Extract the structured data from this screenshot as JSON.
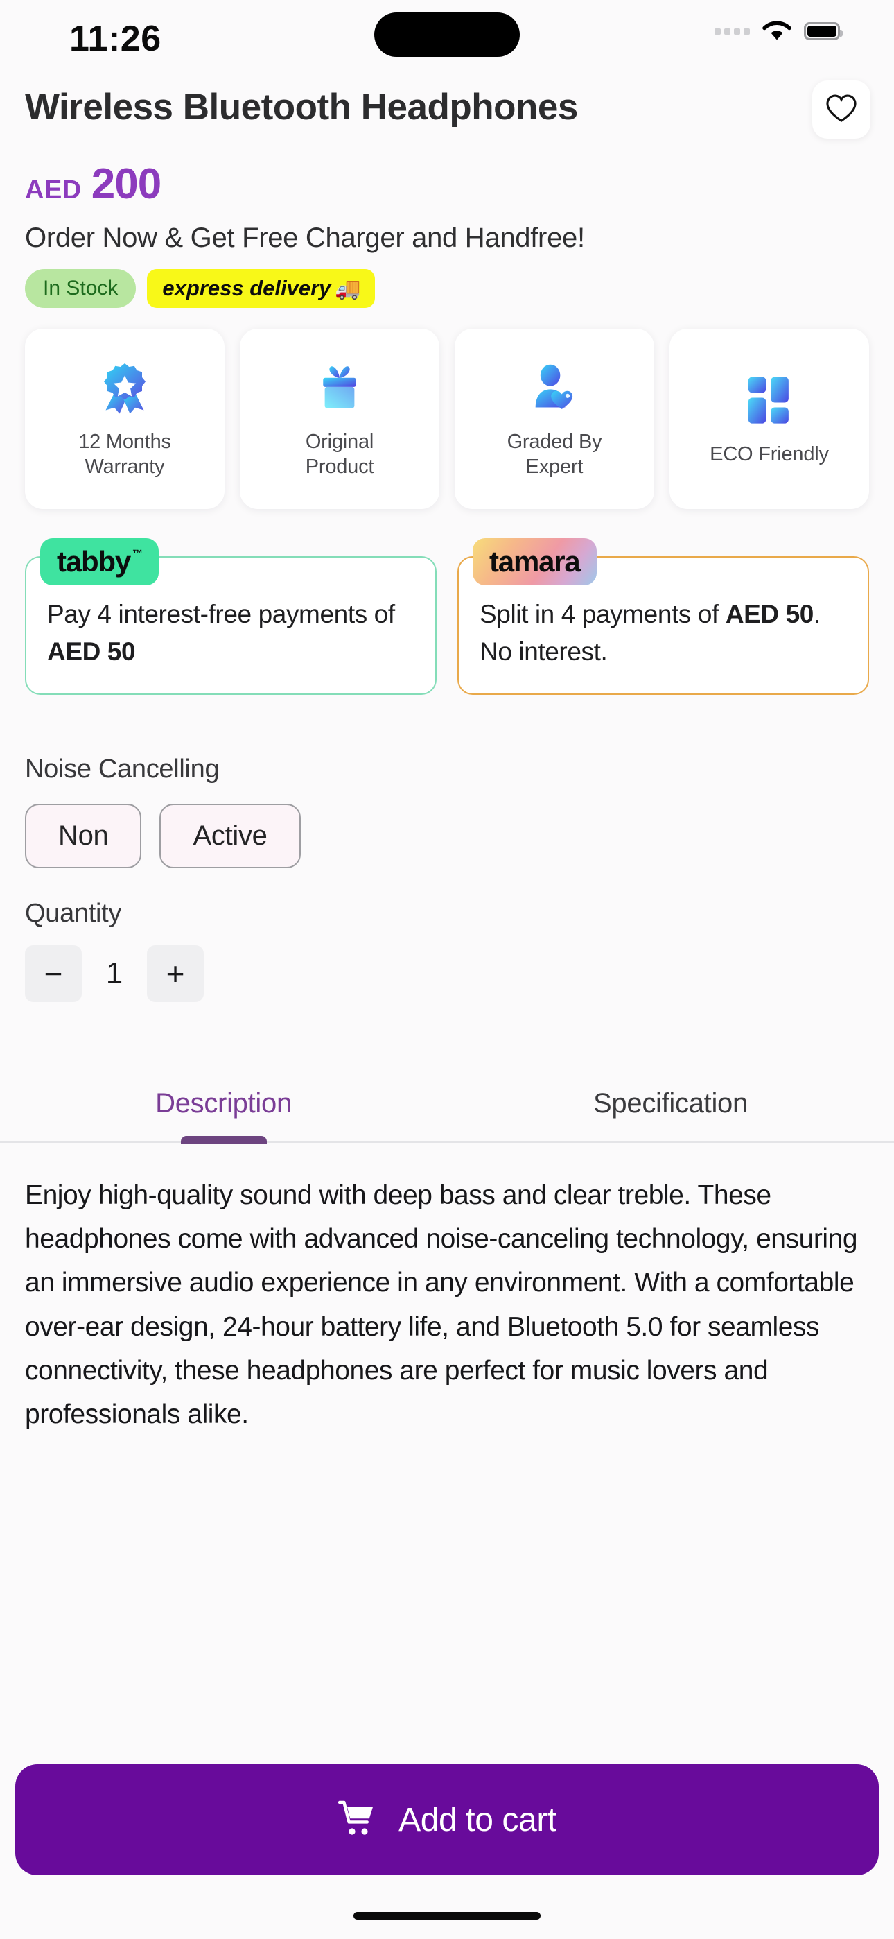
{
  "status_bar": {
    "time": "11:26",
    "icons": [
      "signal-dots-icon",
      "wifi-icon",
      "battery-icon"
    ]
  },
  "header": {
    "title": "Wireless Bluetooth Headphones",
    "favorite_icon": "heart-outline-icon"
  },
  "price": {
    "currency": "AED",
    "amount": "200",
    "color": "#8c3bbd"
  },
  "promo_text": "Order Now & Get Free Charger and Handfree!",
  "badges": {
    "stock": "In Stock",
    "stock_bg": "#b8e6a0",
    "stock_color": "#1d6b1d",
    "express": "express delivery",
    "express_icon": "🚚",
    "express_bg": "#f8f818"
  },
  "features": [
    {
      "icon": "medal-badge-icon",
      "label": "12 Months\nWarranty",
      "line1": "12 Months",
      "line2": "Warranty"
    },
    {
      "icon": "gift-box-icon",
      "label": "Original Product",
      "line1": "Original",
      "line2": "Product"
    },
    {
      "icon": "person-heart-icon",
      "label": "Graded By Expert",
      "line1": "Graded By",
      "line2": "Expert"
    },
    {
      "icon": "grid-blocks-icon",
      "label": "ECO Friendly",
      "line1": "ECO Friendly",
      "line2": ""
    }
  ],
  "bnpl": [
    {
      "brand": "tabby",
      "trademark": "™",
      "text_plain": "Pay 4 interest-free payments of AED 50",
      "text_pre": "Pay 4 interest-free payments of ",
      "text_bold": "AED 50",
      "text_post": "",
      "border_color": "#84ddb8",
      "badge_color": "#3fe3a0"
    },
    {
      "brand": "tamara",
      "trademark": "",
      "text_plain": "Split in 4 payments of AED 50. No interest.",
      "text_pre": "Split in 4 payments of ",
      "text_bold": "AED 50",
      "text_post": ". No interest.",
      "border_color": "#e9a94a",
      "badge_color": "gradient-yellow-pink-blue"
    }
  ],
  "options": {
    "noise_label": "Noise Cancelling",
    "noise_values": [
      "Non",
      "Active"
    ],
    "quantity_label": "Quantity",
    "quantity_value": "1",
    "minus_icon": "−",
    "plus_icon": "+"
  },
  "tabs": [
    {
      "label": "Description",
      "active": true
    },
    {
      "label": "Specification",
      "active": false
    }
  ],
  "description": "Enjoy high-quality sound with deep bass and clear treble. These headphones come with advanced noise-canceling technology, ensuring an immersive audio experience in any environment. With a comfortable over-ear design, 24-hour battery life, and Bluetooth 5.0 for seamless connectivity, these headphones are perfect for music lovers and professionals alike.",
  "cart": {
    "label": "Add to cart",
    "icon": "shopping-cart-icon",
    "bg": "#680B9B"
  }
}
